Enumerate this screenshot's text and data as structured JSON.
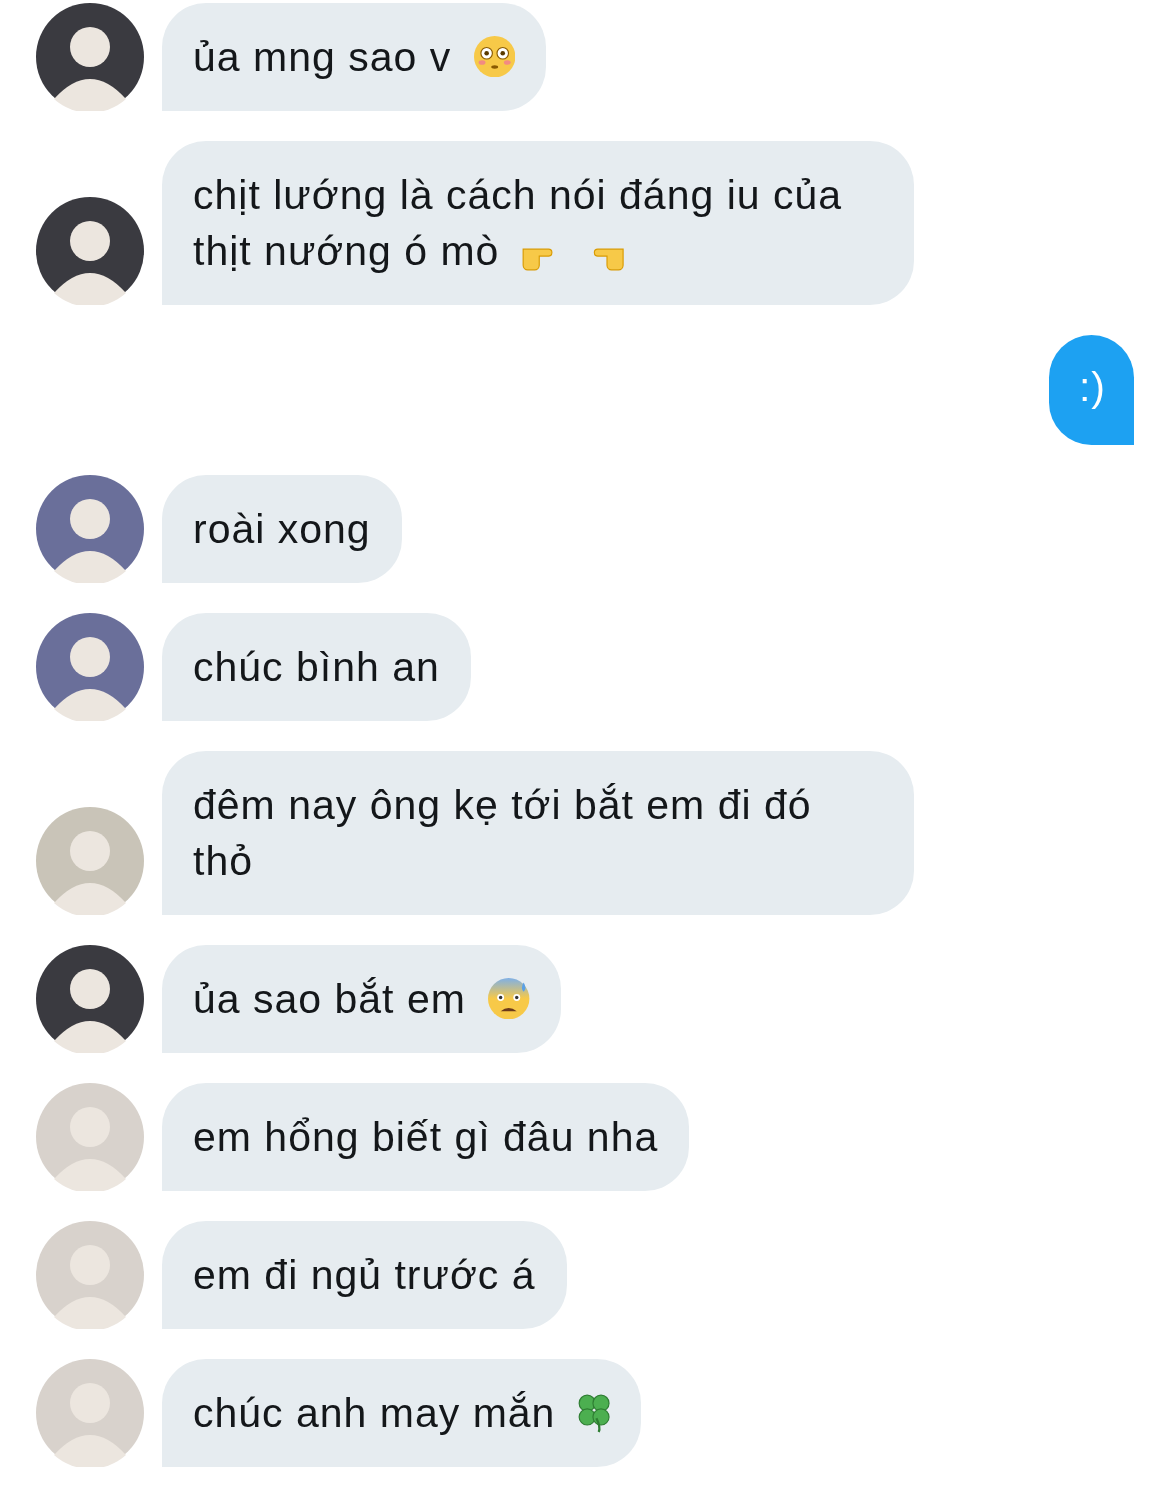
{
  "messages": [
    {
      "kind": "incoming",
      "color": "#3a3a40",
      "text": "ủa mng sao v",
      "icons": [
        {
          "kind": "flushed-face"
        }
      ]
    },
    {
      "kind": "incoming",
      "color": "#3a3a40",
      "text": "chịt lướng là cách nói đáng iu của thịt nướng ó mò",
      "icons": [
        {
          "kind": "pointing-right"
        },
        {
          "kind": "pointing-left"
        }
      ]
    },
    {
      "kind": "outgoing",
      "text": ":)"
    },
    {
      "kind": "incoming",
      "color": "#6a6f9a",
      "text": "roài xong"
    },
    {
      "kind": "incoming",
      "color": "#6a6f9a",
      "text": "chúc bình an"
    },
    {
      "kind": "incoming",
      "color": "#c9c4b8",
      "text": "đêm nay ông kẹ tới bắt em đi đó thỏ"
    },
    {
      "kind": "incoming",
      "color": "#3a3a40",
      "text": "ủa sao bắt em",
      "icons": [
        {
          "kind": "anxious-face"
        }
      ]
    },
    {
      "kind": "incoming",
      "color": "#d8d2cc",
      "text": "em hổng biết gì đâu nha"
    },
    {
      "kind": "incoming",
      "color": "#d8d2cc",
      "text": "em đi ngủ trước á"
    },
    {
      "kind": "incoming",
      "color": "#d8d2cc",
      "text": "chúc anh may mắn",
      "icons": [
        {
          "kind": "clover"
        }
      ]
    }
  ]
}
